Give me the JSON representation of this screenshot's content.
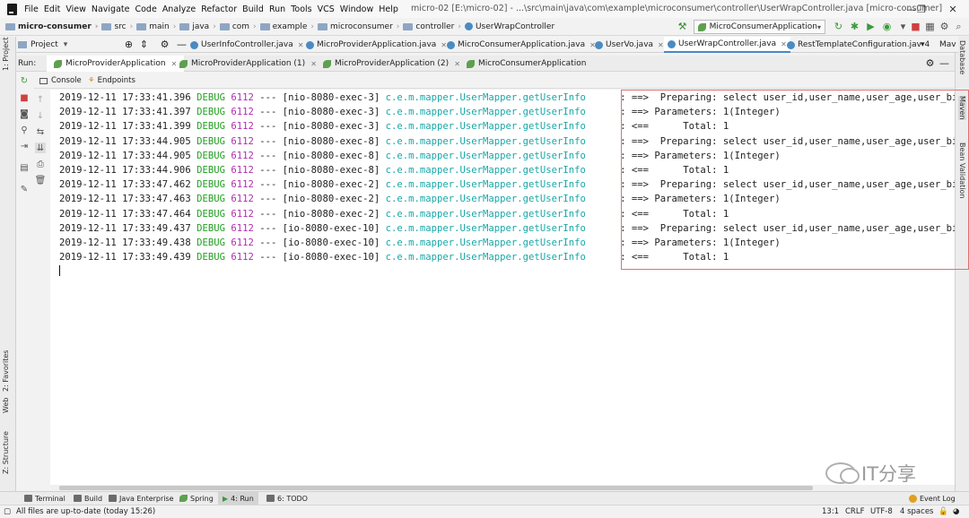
{
  "menu": [
    "File",
    "Edit",
    "View",
    "Navigate",
    "Code",
    "Analyze",
    "Refactor",
    "Build",
    "Run",
    "Tools",
    "VCS",
    "Window",
    "Help"
  ],
  "window_title": "micro-02 [E:\\micro-02] - ...\\src\\main\\java\\com\\example\\microconsumer\\controller\\UserWrapController.java [micro-consumer]",
  "breadcrumbs": [
    "micro-consumer",
    "src",
    "main",
    "java",
    "com",
    "example",
    "microconsumer",
    "controller",
    "UserWrapController"
  ],
  "run_config": "MicroConsumerApplication",
  "project_dropdown": "Project",
  "editor_tabs": [
    {
      "label": "UserInfoController.java"
    },
    {
      "label": "MicroProviderApplication.java"
    },
    {
      "label": "MicroConsumerApplication.java"
    },
    {
      "label": "UserVo.java"
    },
    {
      "label": "UserWrapController.java"
    },
    {
      "label": "RestTemplateConfiguration.jav"
    }
  ],
  "tabs_overflow": "4",
  "tabs_more": "Mav",
  "run_label": "Run:",
  "run_tabs": [
    {
      "label": "MicroProviderApplication"
    },
    {
      "label": "MicroProviderApplication (1)"
    },
    {
      "label": "MicroProviderApplication (2)"
    },
    {
      "label": "MicroConsumerApplication"
    }
  ],
  "sub_tabs": [
    "Console",
    "Endpoints"
  ],
  "left_strip": {
    "project": "1: Project",
    "favorites": "2: Favorites",
    "web": "Web",
    "structure": "Z: Structure"
  },
  "right_strip": {
    "database": "Database",
    "maven": "Maven",
    "bean": "Bean Validation"
  },
  "log_lines": [
    {
      "ts": "2019-12-11 17:33:41.396",
      "level": "DEBUG",
      "pid": "6112",
      "thread": "--- [nio-8080-exec-3]",
      "cls": "c.e.m.mapper.UserMapper.getUserInfo",
      "msg": "     : ==>  Preparing: select user_id,user_name,user_age,user_birth f"
    },
    {
      "ts": "2019-12-11 17:33:41.397",
      "level": "DEBUG",
      "pid": "6112",
      "thread": "--- [nio-8080-exec-3]",
      "cls": "c.e.m.mapper.UserMapper.getUserInfo",
      "msg": "     : ==> Parameters: 1(Integer)"
    },
    {
      "ts": "2019-12-11 17:33:41.399",
      "level": "DEBUG",
      "pid": "6112",
      "thread": "--- [nio-8080-exec-3]",
      "cls": "c.e.m.mapper.UserMapper.getUserInfo",
      "msg": "     : <==      Total: 1"
    },
    {
      "ts": "2019-12-11 17:33:44.905",
      "level": "DEBUG",
      "pid": "6112",
      "thread": "--- [nio-8080-exec-8]",
      "cls": "c.e.m.mapper.UserMapper.getUserInfo",
      "msg": "     : ==>  Preparing: select user_id,user_name,user_age,user_birth f"
    },
    {
      "ts": "2019-12-11 17:33:44.905",
      "level": "DEBUG",
      "pid": "6112",
      "thread": "--- [nio-8080-exec-8]",
      "cls": "c.e.m.mapper.UserMapper.getUserInfo",
      "msg": "     : ==> Parameters: 1(Integer)"
    },
    {
      "ts": "2019-12-11 17:33:44.906",
      "level": "DEBUG",
      "pid": "6112",
      "thread": "--- [nio-8080-exec-8]",
      "cls": "c.e.m.mapper.UserMapper.getUserInfo",
      "msg": "     : <==      Total: 1"
    },
    {
      "ts": "2019-12-11 17:33:47.462",
      "level": "DEBUG",
      "pid": "6112",
      "thread": "--- [nio-8080-exec-2]",
      "cls": "c.e.m.mapper.UserMapper.getUserInfo",
      "msg": "     : ==>  Preparing: select user_id,user_name,user_age,user_birth f"
    },
    {
      "ts": "2019-12-11 17:33:47.463",
      "level": "DEBUG",
      "pid": "6112",
      "thread": "--- [nio-8080-exec-2]",
      "cls": "c.e.m.mapper.UserMapper.getUserInfo",
      "msg": "     : ==> Parameters: 1(Integer)"
    },
    {
      "ts": "2019-12-11 17:33:47.464",
      "level": "DEBUG",
      "pid": "6112",
      "thread": "--- [nio-8080-exec-2]",
      "cls": "c.e.m.mapper.UserMapper.getUserInfo",
      "msg": "     : <==      Total: 1"
    },
    {
      "ts": "2019-12-11 17:33:49.437",
      "level": "DEBUG",
      "pid": "6112",
      "thread": "--- [io-8080-exec-10]",
      "cls": "c.e.m.mapper.UserMapper.getUserInfo",
      "msg": "     : ==>  Preparing: select user_id,user_name,user_age,user_birth f"
    },
    {
      "ts": "2019-12-11 17:33:49.438",
      "level": "DEBUG",
      "pid": "6112",
      "thread": "--- [io-8080-exec-10]",
      "cls": "c.e.m.mapper.UserMapper.getUserInfo",
      "msg": "     : ==> Parameters: 1(Integer)"
    },
    {
      "ts": "2019-12-11 17:33:49.439",
      "level": "DEBUG",
      "pid": "6112",
      "thread": "--- [io-8080-exec-10]",
      "cls": "c.e.m.mapper.UserMapper.getUserInfo",
      "msg": "     : <==      Total: 1"
    }
  ],
  "watermark": "IT分享",
  "bottom_tabs": [
    {
      "label": "Terminal",
      "active": false
    },
    {
      "label": "Build",
      "active": false
    },
    {
      "label": "Java Enterprise",
      "active": false
    },
    {
      "label": "Spring",
      "active": false
    },
    {
      "label": "4: Run",
      "active": true
    },
    {
      "label": "6: TODO",
      "active": false
    }
  ],
  "event_log": "Event Log",
  "status": {
    "message": "All files are up-to-date (today 15:26)",
    "position": "13:1",
    "line_sep": "CRLF",
    "encoding": "UTF-8",
    "indent": "4 spaces"
  },
  "colors": {
    "debug": "#22a022",
    "pid": "#b02db0",
    "logger": "#1aa7a7",
    "highlight": "#e07070"
  }
}
